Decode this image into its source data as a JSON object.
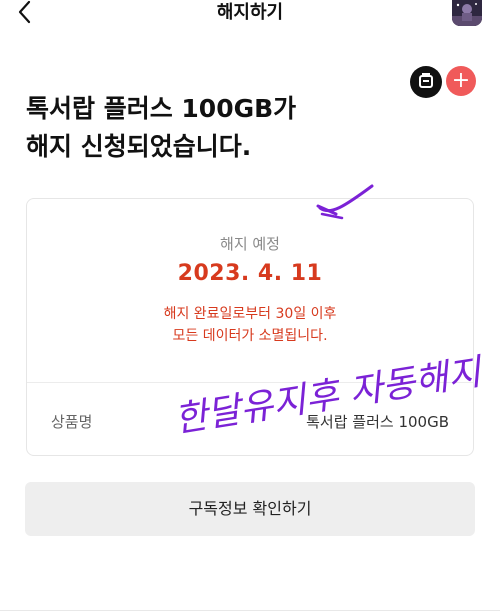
{
  "header": {
    "title": "해지하기",
    "back_icon": "chevron-left-icon",
    "avatar_icon": "profile-avatar"
  },
  "floating": {
    "chat_icon": "chat-bubble-icon",
    "plus_label": "+",
    "plus_color": "#f05a5a"
  },
  "headline": {
    "line1": "톡서랍 플러스 100GB가",
    "line2": "해지 신청되었습니다."
  },
  "card": {
    "label": "해지 예정",
    "date": "2023. 4. 11",
    "note_line1": "해지 완료일로부터 30일 이후",
    "note_line2": "모든 데이터가 소멸됩니다.",
    "accent_color": "#d73a1e",
    "product_label": "상품명",
    "product_value": "톡서랍 플러스 100GB"
  },
  "annotation": {
    "handwritten_text": "한달유지후 자동해지",
    "ink_color": "#8a2be2"
  },
  "confirm_button": {
    "label": "구독정보 확인하기"
  }
}
